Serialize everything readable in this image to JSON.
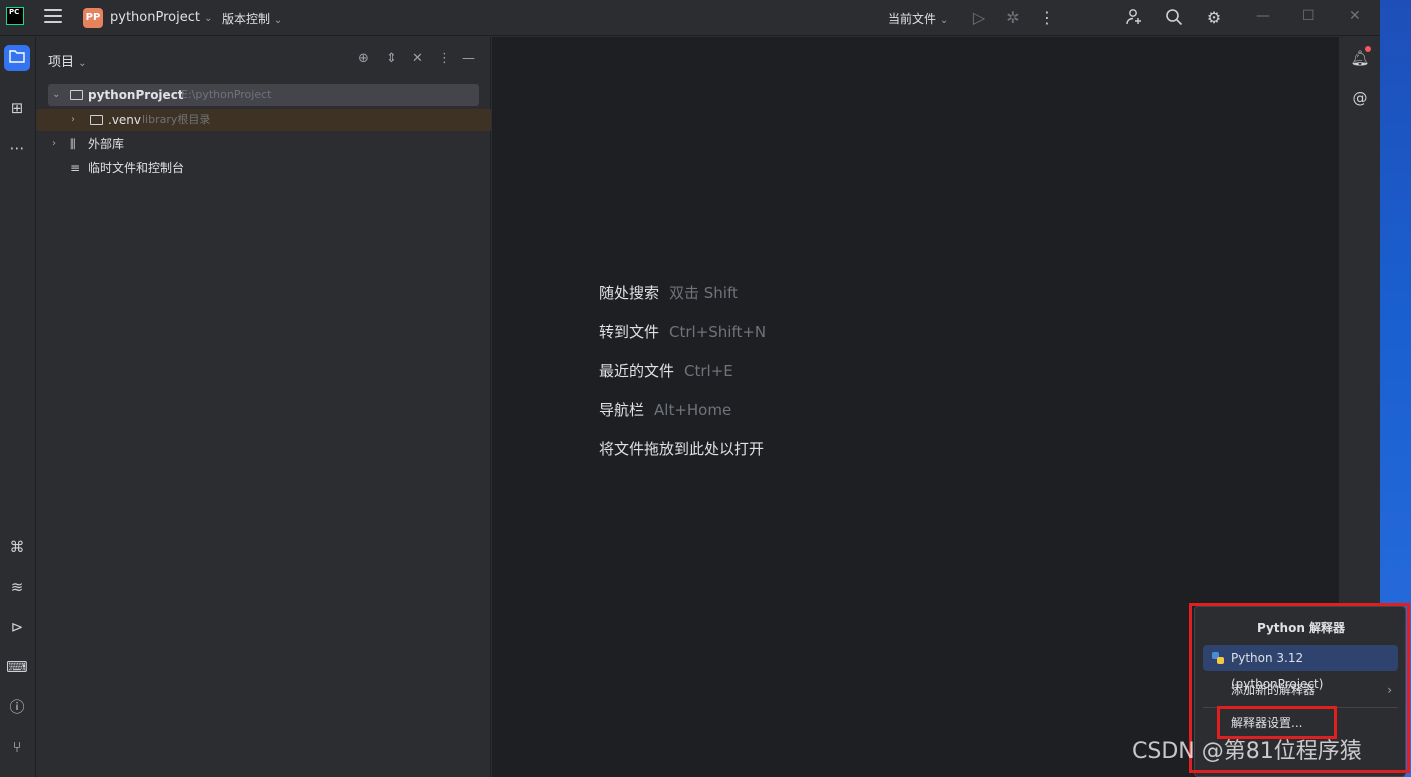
{
  "titlebar": {
    "logo_text": "PC",
    "project_badge": "PP",
    "project_name": "pythonProject",
    "vcs_label": "版本控制",
    "current_file_label": "当前文件"
  },
  "project_panel": {
    "title": "项目",
    "tree": [
      {
        "label": "pythonProject",
        "hint": "E:\\pythonProject"
      },
      {
        "label": ".venv",
        "hint": "library根目录"
      },
      {
        "label": "外部库",
        "hint": ""
      },
      {
        "label": "临时文件和控制台",
        "hint": ""
      }
    ]
  },
  "editor": {
    "hints": [
      {
        "action": "随处搜索",
        "key": "双击 Shift"
      },
      {
        "action": "转到文件",
        "key": "Ctrl+Shift+N"
      },
      {
        "action": "最近的文件",
        "key": "Ctrl+E"
      },
      {
        "action": "导航栏",
        "key": "Alt+Home"
      },
      {
        "action": "将文件拖放到此处以打开",
        "key": ""
      }
    ]
  },
  "popup": {
    "title": "Python 解释器",
    "items": [
      {
        "label": "Python 3.12 (pythonProject)",
        "selected": true
      },
      {
        "label": "添加新的解释器",
        "submenu": true
      },
      {
        "label": "解释器设置..."
      }
    ]
  },
  "watermark": "CSDN @第81位程序猿",
  "colors": {
    "accent": "#3574f0",
    "highlight_box": "#e02020",
    "project_badge": "#e6825e"
  }
}
